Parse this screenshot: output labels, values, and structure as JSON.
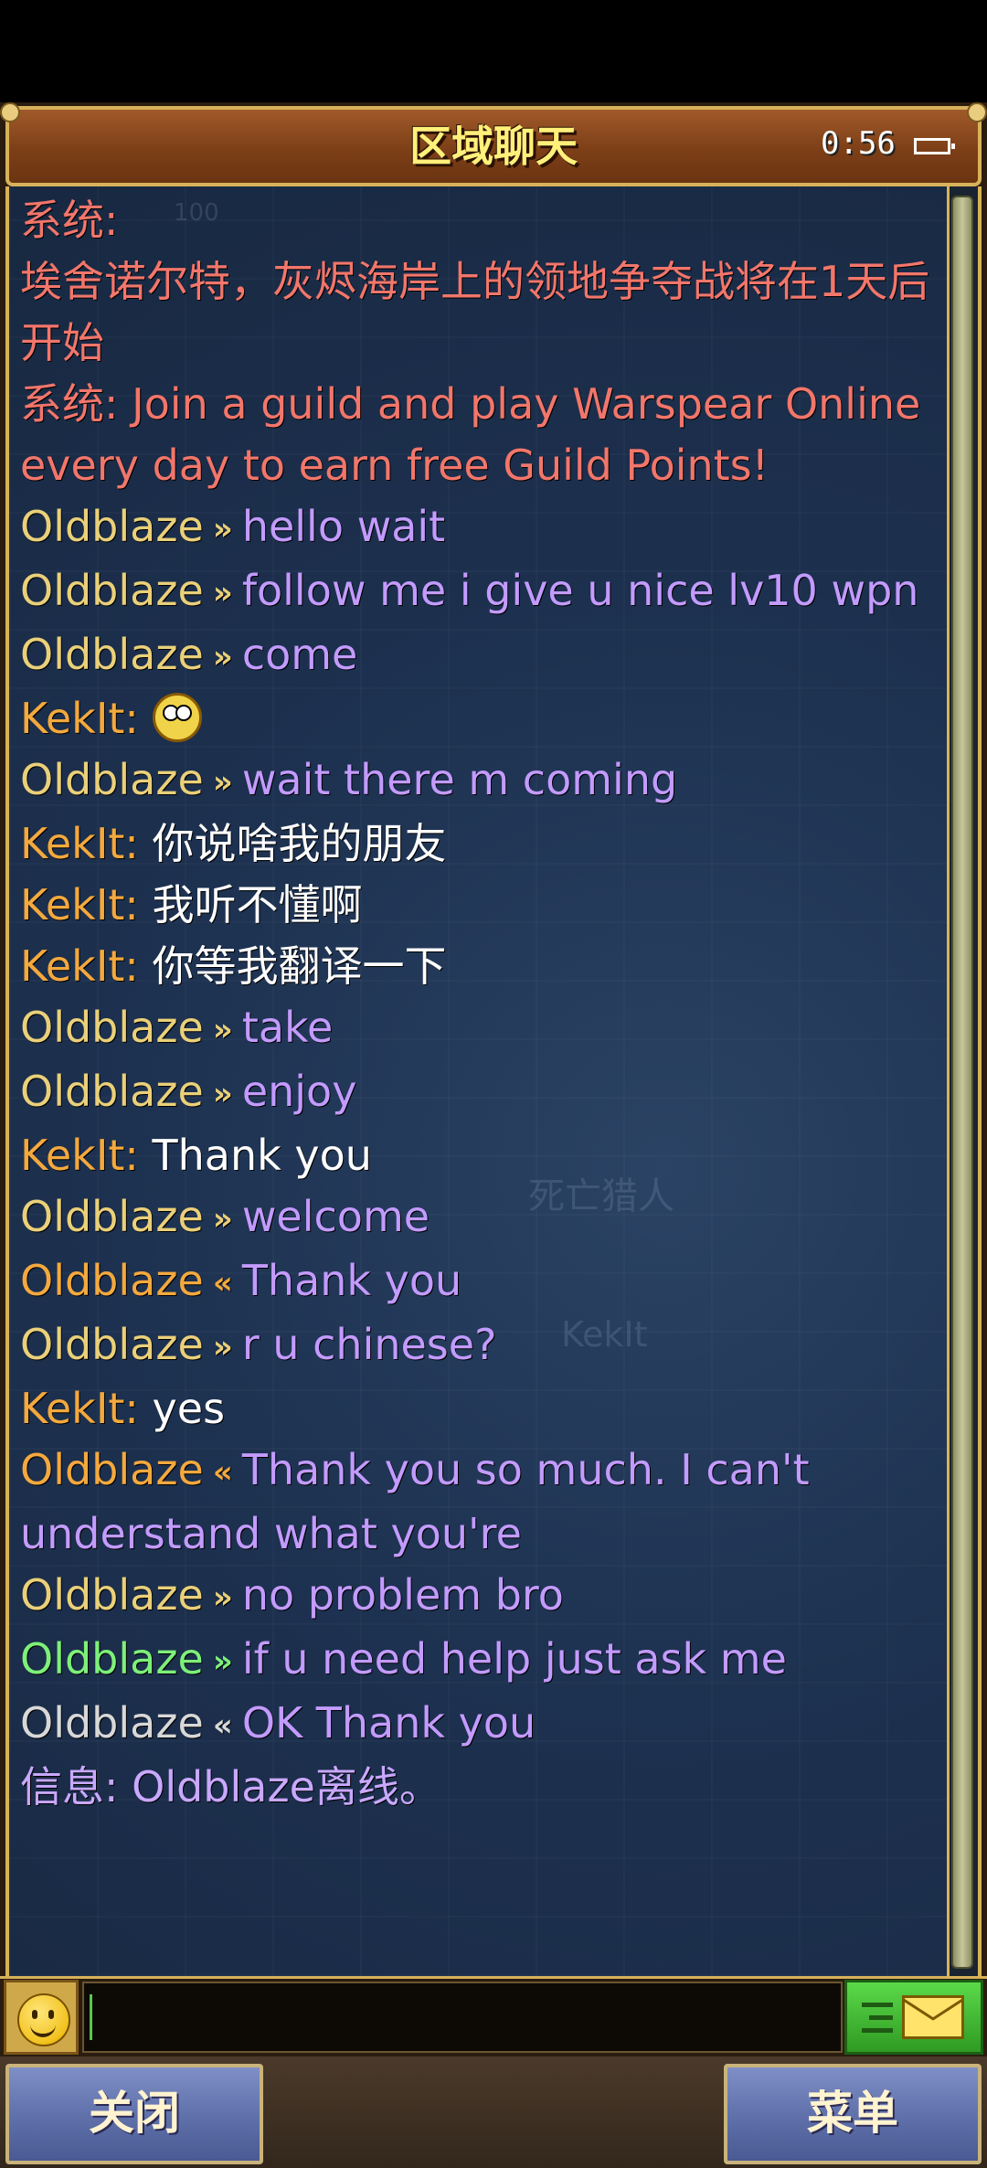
{
  "header": {
    "title": "区域聊天",
    "clock": "0:56"
  },
  "background_labels": {
    "level_text": "100",
    "npc_name": "死亡猎人",
    "player_name": "KekIt"
  },
  "messages": [
    {
      "sender": "系统:",
      "text": "",
      "style": "system"
    },
    {
      "sender": "",
      "text": "埃舍诺尔特，灰烬海岸上的领地争夺战将在1天后开始",
      "style": "system"
    },
    {
      "sender": "系统:",
      "text": " Join a guild and play Warspear Online every day to earn free Guild Points!",
      "style": "system"
    },
    {
      "sender": "Oldblaze",
      "arrow": "»",
      "text": "hello wait",
      "sender_color": "yellow",
      "text_color": "purple"
    },
    {
      "sender": "Oldblaze",
      "arrow": "»",
      "text": "follow me i give u nice lv10 wpn",
      "sender_color": "yellow",
      "text_color": "purple"
    },
    {
      "sender": "Oldblaze",
      "arrow": "»",
      "text": "come",
      "sender_color": "yellow",
      "text_color": "purple"
    },
    {
      "sender": "KekIt:",
      "text": "",
      "emoji": "surprised-face",
      "sender_color": "orange",
      "text_color": "white"
    },
    {
      "sender": "Oldblaze",
      "arrow": "»",
      "text": "wait there m coming",
      "sender_color": "yellow",
      "text_color": "purple"
    },
    {
      "sender": "KekIt:",
      "text": " 你说啥我的朋友",
      "sender_color": "orange",
      "text_color": "white"
    },
    {
      "sender": "KekIt:",
      "text": " 我听不懂啊",
      "sender_color": "orange",
      "text_color": "white"
    },
    {
      "sender": "KekIt:",
      "text": " 你等我翻译一下",
      "sender_color": "orange",
      "text_color": "white"
    },
    {
      "sender": "Oldblaze",
      "arrow": "»",
      "text": "take",
      "sender_color": "yellow",
      "text_color": "purple"
    },
    {
      "sender": "Oldblaze",
      "arrow": "»",
      "text": "enjoy",
      "sender_color": "yellow",
      "text_color": "purple"
    },
    {
      "sender": "KekIt:",
      "text": " Thank you",
      "sender_color": "orange",
      "text_color": "white"
    },
    {
      "sender": "Oldblaze",
      "arrow": "»",
      "text": "welcome",
      "sender_color": "yellow",
      "text_color": "purple"
    },
    {
      "sender": "Oldblaze",
      "arrow": "«",
      "text": "Thank you",
      "sender_color": "orange",
      "text_color": "purple"
    },
    {
      "sender": "Oldblaze",
      "arrow": "»",
      "text": "r u chinese?",
      "sender_color": "yellow",
      "text_color": "purple"
    },
    {
      "sender": "KekIt:",
      "text": " yes",
      "sender_color": "orange",
      "text_color": "white"
    },
    {
      "sender": "Oldblaze",
      "arrow": "«",
      "text": "Thank you so much. I can't understand what you're",
      "sender_color": "orange",
      "text_color": "purple"
    },
    {
      "sender": "Oldblaze",
      "arrow": "»",
      "text": "no problem bro",
      "sender_color": "yellow",
      "text_color": "purple"
    },
    {
      "sender": "Oldblaze",
      "arrow": "»",
      "text": "if u need help just ask me",
      "sender_color": "green",
      "text_color": "purple"
    },
    {
      "sender": "Oldblaze",
      "arrow": "«",
      "text": "OK Thank you",
      "sender_color": "grey",
      "text_color": "purple"
    },
    {
      "sender": "信息:",
      "text": " Oldblaze离线。",
      "style": "info"
    }
  ],
  "input": {
    "value": "",
    "placeholder": ""
  },
  "buttons": {
    "close_label": "关闭",
    "menu_label": "菜单"
  },
  "colors": {
    "title": "#fff07a",
    "system": "#f2766b",
    "info": "#c9a8ff",
    "frame_gold": "#d8b25a",
    "chat_bg": "#1d3150"
  }
}
